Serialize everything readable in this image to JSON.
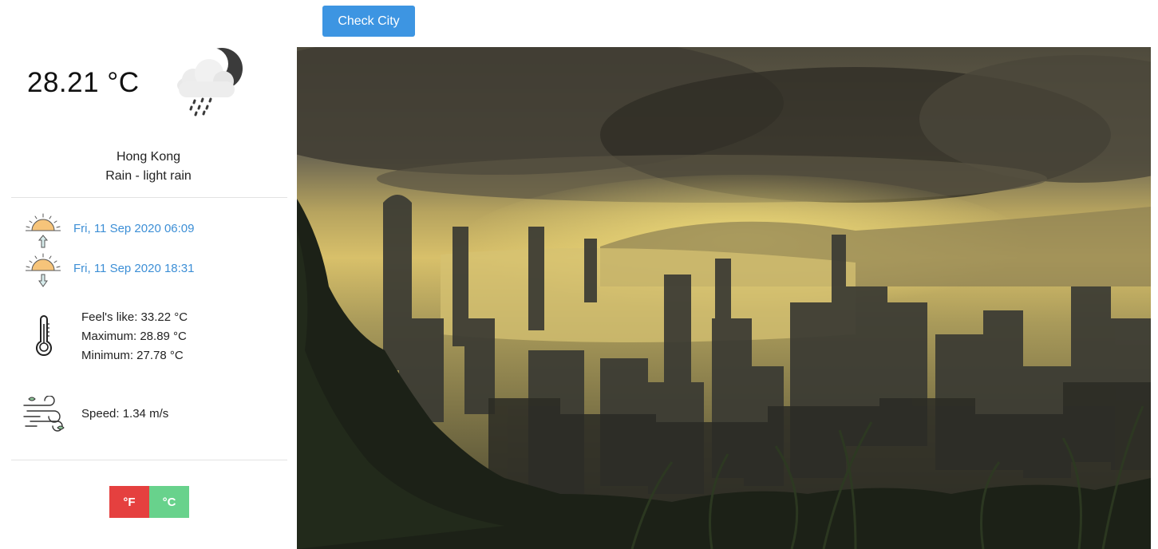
{
  "current": {
    "temperature": "28.21 °C",
    "condition_icon": "cloud-moon-rain-icon",
    "city": "Hong Kong",
    "description": "Rain - light rain"
  },
  "sun": {
    "sunrise": "Fri, 11 Sep 2020 06:09",
    "sunset": "Fri, 11 Sep 2020 18:31"
  },
  "details": {
    "feels_like": "Feel's like: 33.22 °C",
    "maximum": "Maximum: 28.89 °C",
    "minimum": "Minimum: 27.78 °C"
  },
  "wind": {
    "speed": "Speed: 1.34 m/s"
  },
  "units": {
    "fahrenheit_label": "°F",
    "celsius_label": "°C"
  },
  "toolbar": {
    "check_city_label": "Check City"
  },
  "colors": {
    "accent": "#3d95e2",
    "link_blue": "#3d8fd6",
    "fahrenheit_red": "#e5403f",
    "celsius_green": "#68d28c"
  },
  "background_image": {
    "icon": "city-skyline-photo"
  }
}
